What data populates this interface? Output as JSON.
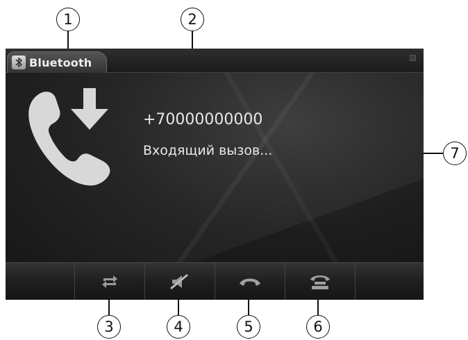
{
  "header": {
    "tab_label": "Bluetooth",
    "tab_icon": "bluetooth-icon"
  },
  "call": {
    "icon": "incoming-call-icon",
    "number": "+70000000000",
    "status": "Входящий вызов..."
  },
  "controls": [
    {
      "name": "switch-audio-button",
      "icon": "swap-arrows-icon"
    },
    {
      "name": "mute-button",
      "icon": "mute-icon"
    },
    {
      "name": "end-call-button",
      "icon": "hang-up-icon"
    },
    {
      "name": "answer-call-button",
      "icon": "answer-phone-icon"
    }
  ],
  "callouts": [
    "1",
    "2",
    "3",
    "4",
    "5",
    "6",
    "7"
  ],
  "colors": {
    "screen_bg": "#262626",
    "text": "#e8e8e8",
    "icon": "#d9d9d9"
  }
}
